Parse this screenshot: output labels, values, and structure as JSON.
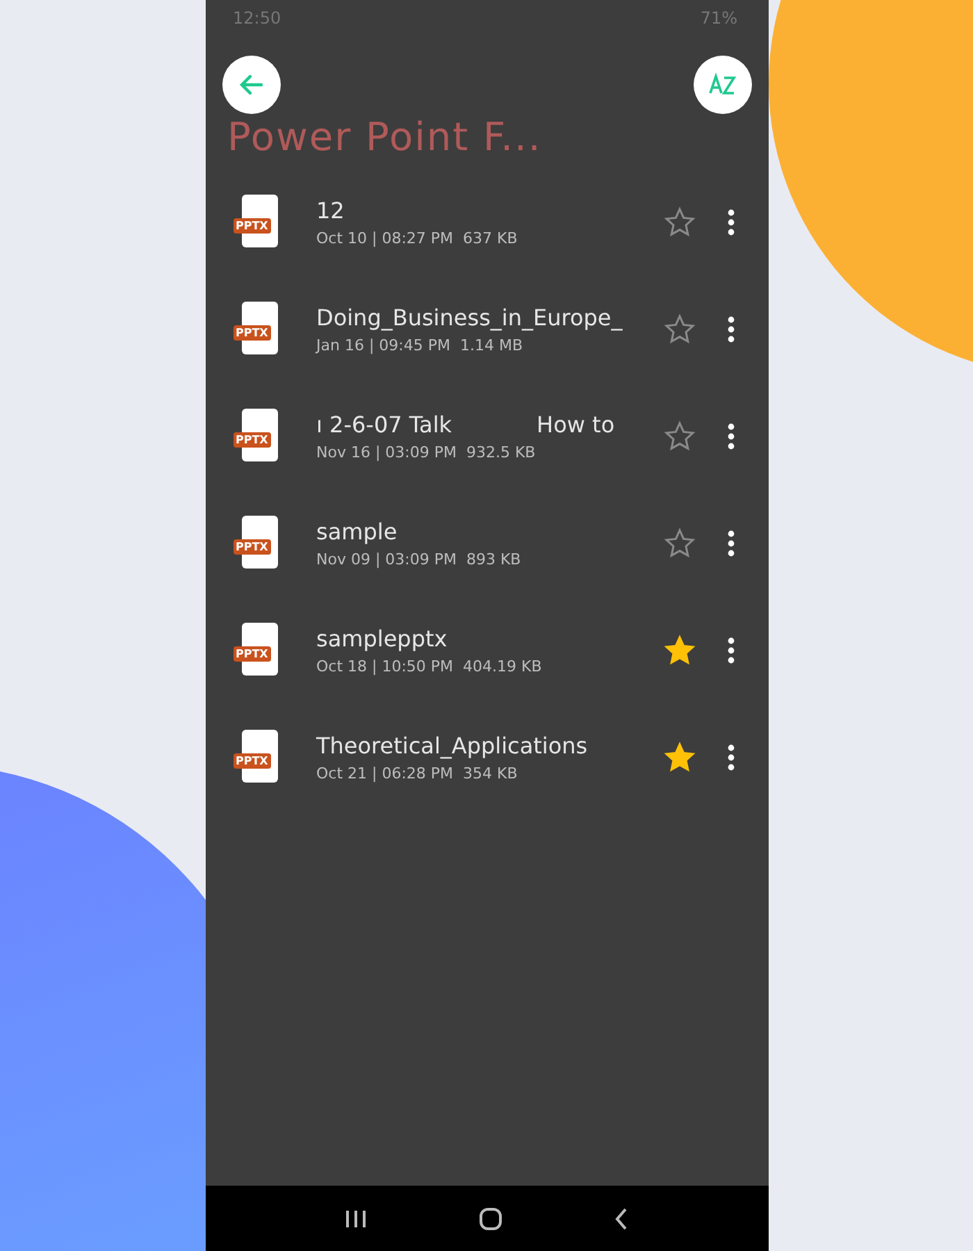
{
  "status_bar": {
    "time": "12:50",
    "battery": "71%"
  },
  "header": {
    "title": "Power Point F..."
  },
  "files": [
    {
      "name": "12",
      "meta": "Oct 10 | 08:27 PM  637 KB",
      "badge": "PPTX",
      "starred": false
    },
    {
      "name": "Doing_Business_in_Europe_",
      "meta": "Jan 16 | 09:45 PM  1.14 MB",
      "badge": "PPTX",
      "starred": false
    },
    {
      "name": "ı 2-6-07 Talk            How to",
      "meta": "Nov 16 | 03:09 PM  932.5 KB",
      "badge": "PPTX",
      "starred": false
    },
    {
      "name": "sample",
      "meta": "Nov 09 | 03:09 PM  893 KB",
      "badge": "PPTX",
      "starred": false
    },
    {
      "name": "samplepptx",
      "meta": "Oct 18 | 10:50 PM  404.19 KB",
      "badge": "PPTX",
      "starred": true
    },
    {
      "name": "Theoretical_Applications",
      "meta": "Oct 21 | 06:28 PM  354 KB",
      "badge": "PPTX",
      "starred": true
    }
  ]
}
